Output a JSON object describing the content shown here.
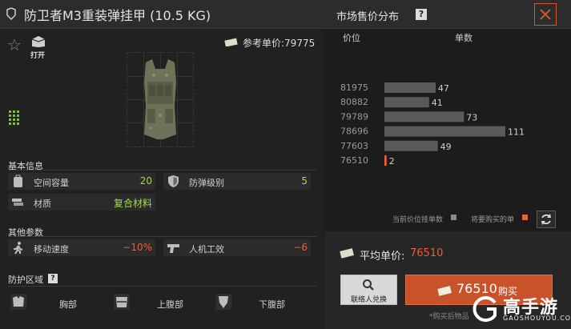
{
  "header": {
    "item_title": "防卫者M3重装弹挂甲 (10.5 KG)",
    "market_title": "市场售价分布",
    "help": "?"
  },
  "item": {
    "open_label": "打开",
    "ref_price_label": "参考单价:",
    "ref_price_value": "79775"
  },
  "basic_info": {
    "title": "基本信息",
    "rows": [
      {
        "label": "空间容量",
        "value": "20",
        "icon": "backpack-icon"
      },
      {
        "label": "防弹级别",
        "value": "5",
        "icon": "shield-icon"
      },
      {
        "label": "材质",
        "value": "复合材料",
        "icon": "material-icon"
      }
    ]
  },
  "other_params": {
    "title": "其他参数",
    "rows": [
      {
        "label": "移动速度",
        "value": "−10%",
        "icon": "running-icon"
      },
      {
        "label": "人机工效",
        "value": "−6",
        "icon": "pistol-icon"
      }
    ]
  },
  "protection": {
    "title": "防护区域",
    "help": "?",
    "zones": [
      {
        "label": "胸部",
        "icon": "chest-icon"
      },
      {
        "label": "上腹部",
        "icon": "upper-abdomen-icon"
      },
      {
        "label": "下腹部",
        "icon": "lower-abdomen-icon"
      }
    ]
  },
  "market": {
    "col_price": "价位",
    "col_units": "单数",
    "legend_current": "当前价位挂单数",
    "legend_mine": "将要购买的单",
    "avg_label": "平均单价:",
    "avg_value": "76510",
    "contact_label": "联络人兑换",
    "buy_price": "76510",
    "buy_label": "购买",
    "footnote": "*购买后物品"
  },
  "colors": {
    "accent": "#e8613a",
    "positive": "#a7d94a",
    "negative": "#e8613a",
    "bar": "#5a5a5a"
  },
  "chart_data": {
    "type": "bar",
    "orientation": "horizontal",
    "xlabel": "单数",
    "ylabel": "价位",
    "categories": [
      "81975",
      "80882",
      "79789",
      "78696",
      "77603",
      "76510"
    ],
    "series": [
      {
        "name": "当前价位挂单数",
        "values": [
          47,
          41,
          73,
          111,
          49,
          2
        ]
      }
    ],
    "highlight_index": 5
  },
  "watermark": {
    "text": "高手游",
    "sub": "GAOSHOUYOU.COM"
  }
}
